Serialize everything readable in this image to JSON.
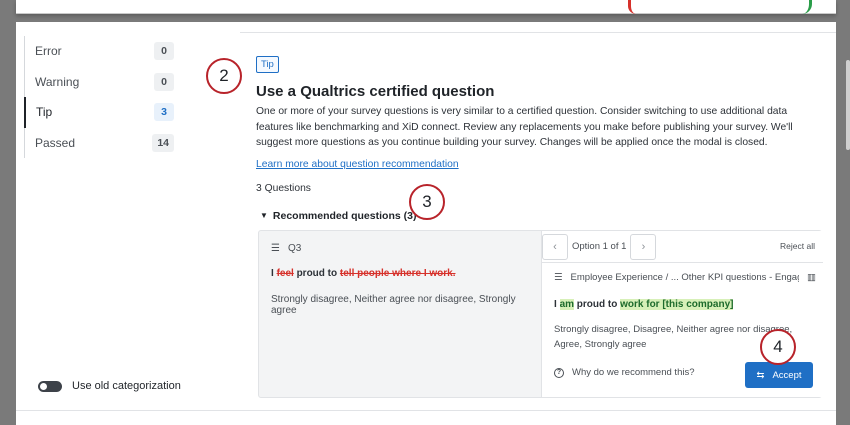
{
  "sidebar": {
    "items": [
      {
        "label": "Error",
        "count": "0"
      },
      {
        "label": "Warning",
        "count": "0"
      },
      {
        "label": "Tip",
        "count": "3"
      },
      {
        "label": "Passed",
        "count": "14"
      }
    ],
    "toggle_label": "Use old categorization"
  },
  "main": {
    "badge": "Tip",
    "title": "Use a Qualtrics certified question",
    "description": "One or more of your survey questions is very similar to a certified question. Consider switching to use additional data features like benchmarking and XiD connect. Review any replacements you make before publishing your survey. We'll suggest more questions as you continue building your survey. Changes will be applied once the modal is closed.",
    "learn_link": "Learn more about question recommendation",
    "question_count": "3 Questions",
    "recommended_toggle": "Recommended questions (3)"
  },
  "original": {
    "id": "Q3",
    "text_parts": [
      "I ",
      "feel",
      " proud to ",
      "tell people where I work."
    ],
    "options": "Strongly disagree, Neither agree nor disagree, Strongly agree"
  },
  "recommendation": {
    "option_label": "Option 1 of 1",
    "reject_label": "Reject all",
    "category": "Employee Experience / ... Other KPI questions - Engagement",
    "text_parts": [
      "I ",
      "am",
      " proud to ",
      "work for [this company]"
    ],
    "options": "Strongly disagree, Disagree, Neither agree nor disagree, Agree, Strongly agree",
    "why_label": "Why do we recommend this?",
    "accept_label": "Accept"
  },
  "callouts": [
    "2",
    "3",
    "4"
  ],
  "colors": {
    "accent": "#1f6fc5",
    "deletion": "#d6312b",
    "insertion_bg": "#d7f0b8",
    "callout_border": "#b8232a"
  },
  "icons": {
    "question": "list-icon",
    "category": "list-icon",
    "certified": "building-icon",
    "help": "question-circle-icon",
    "accept": "swap-arrows-icon",
    "prev": "chevron-left-icon",
    "next": "chevron-right-icon",
    "expand": "caret-down-icon"
  }
}
